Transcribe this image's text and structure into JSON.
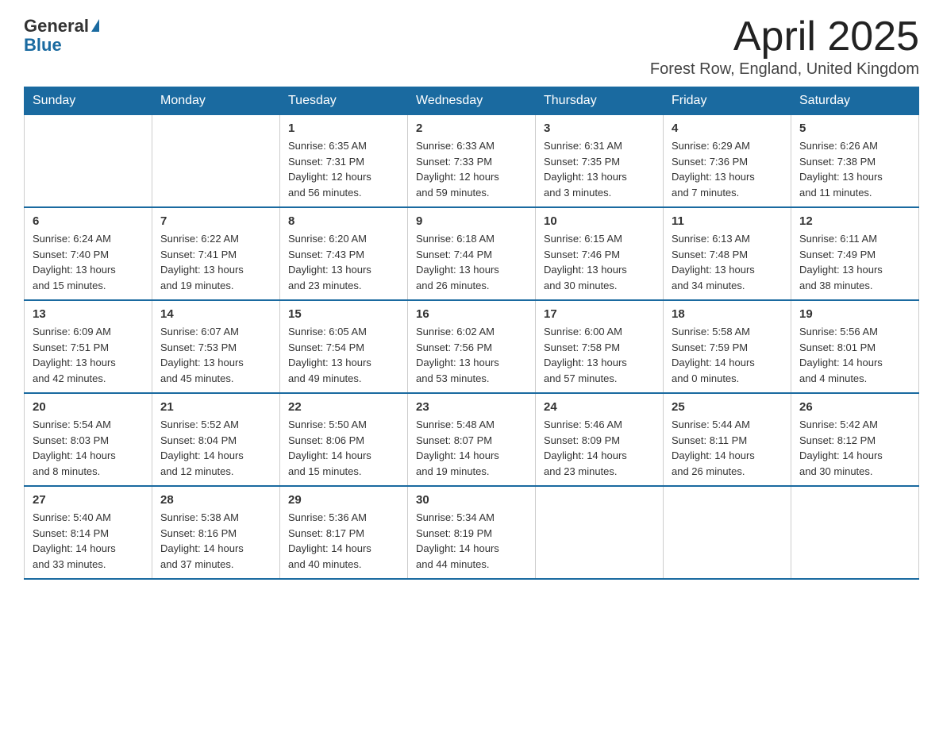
{
  "header": {
    "logo_general": "General",
    "logo_blue": "Blue",
    "month_title": "April 2025",
    "location": "Forest Row, England, United Kingdom"
  },
  "days_of_week": [
    "Sunday",
    "Monday",
    "Tuesday",
    "Wednesday",
    "Thursday",
    "Friday",
    "Saturday"
  ],
  "weeks": [
    [
      {
        "day": "",
        "info": ""
      },
      {
        "day": "",
        "info": ""
      },
      {
        "day": "1",
        "info": "Sunrise: 6:35 AM\nSunset: 7:31 PM\nDaylight: 12 hours\nand 56 minutes."
      },
      {
        "day": "2",
        "info": "Sunrise: 6:33 AM\nSunset: 7:33 PM\nDaylight: 12 hours\nand 59 minutes."
      },
      {
        "day": "3",
        "info": "Sunrise: 6:31 AM\nSunset: 7:35 PM\nDaylight: 13 hours\nand 3 minutes."
      },
      {
        "day": "4",
        "info": "Sunrise: 6:29 AM\nSunset: 7:36 PM\nDaylight: 13 hours\nand 7 minutes."
      },
      {
        "day": "5",
        "info": "Sunrise: 6:26 AM\nSunset: 7:38 PM\nDaylight: 13 hours\nand 11 minutes."
      }
    ],
    [
      {
        "day": "6",
        "info": "Sunrise: 6:24 AM\nSunset: 7:40 PM\nDaylight: 13 hours\nand 15 minutes."
      },
      {
        "day": "7",
        "info": "Sunrise: 6:22 AM\nSunset: 7:41 PM\nDaylight: 13 hours\nand 19 minutes."
      },
      {
        "day": "8",
        "info": "Sunrise: 6:20 AM\nSunset: 7:43 PM\nDaylight: 13 hours\nand 23 minutes."
      },
      {
        "day": "9",
        "info": "Sunrise: 6:18 AM\nSunset: 7:44 PM\nDaylight: 13 hours\nand 26 minutes."
      },
      {
        "day": "10",
        "info": "Sunrise: 6:15 AM\nSunset: 7:46 PM\nDaylight: 13 hours\nand 30 minutes."
      },
      {
        "day": "11",
        "info": "Sunrise: 6:13 AM\nSunset: 7:48 PM\nDaylight: 13 hours\nand 34 minutes."
      },
      {
        "day": "12",
        "info": "Sunrise: 6:11 AM\nSunset: 7:49 PM\nDaylight: 13 hours\nand 38 minutes."
      }
    ],
    [
      {
        "day": "13",
        "info": "Sunrise: 6:09 AM\nSunset: 7:51 PM\nDaylight: 13 hours\nand 42 minutes."
      },
      {
        "day": "14",
        "info": "Sunrise: 6:07 AM\nSunset: 7:53 PM\nDaylight: 13 hours\nand 45 minutes."
      },
      {
        "day": "15",
        "info": "Sunrise: 6:05 AM\nSunset: 7:54 PM\nDaylight: 13 hours\nand 49 minutes."
      },
      {
        "day": "16",
        "info": "Sunrise: 6:02 AM\nSunset: 7:56 PM\nDaylight: 13 hours\nand 53 minutes."
      },
      {
        "day": "17",
        "info": "Sunrise: 6:00 AM\nSunset: 7:58 PM\nDaylight: 13 hours\nand 57 minutes."
      },
      {
        "day": "18",
        "info": "Sunrise: 5:58 AM\nSunset: 7:59 PM\nDaylight: 14 hours\nand 0 minutes."
      },
      {
        "day": "19",
        "info": "Sunrise: 5:56 AM\nSunset: 8:01 PM\nDaylight: 14 hours\nand 4 minutes."
      }
    ],
    [
      {
        "day": "20",
        "info": "Sunrise: 5:54 AM\nSunset: 8:03 PM\nDaylight: 14 hours\nand 8 minutes."
      },
      {
        "day": "21",
        "info": "Sunrise: 5:52 AM\nSunset: 8:04 PM\nDaylight: 14 hours\nand 12 minutes."
      },
      {
        "day": "22",
        "info": "Sunrise: 5:50 AM\nSunset: 8:06 PM\nDaylight: 14 hours\nand 15 minutes."
      },
      {
        "day": "23",
        "info": "Sunrise: 5:48 AM\nSunset: 8:07 PM\nDaylight: 14 hours\nand 19 minutes."
      },
      {
        "day": "24",
        "info": "Sunrise: 5:46 AM\nSunset: 8:09 PM\nDaylight: 14 hours\nand 23 minutes."
      },
      {
        "day": "25",
        "info": "Sunrise: 5:44 AM\nSunset: 8:11 PM\nDaylight: 14 hours\nand 26 minutes."
      },
      {
        "day": "26",
        "info": "Sunrise: 5:42 AM\nSunset: 8:12 PM\nDaylight: 14 hours\nand 30 minutes."
      }
    ],
    [
      {
        "day": "27",
        "info": "Sunrise: 5:40 AM\nSunset: 8:14 PM\nDaylight: 14 hours\nand 33 minutes."
      },
      {
        "day": "28",
        "info": "Sunrise: 5:38 AM\nSunset: 8:16 PM\nDaylight: 14 hours\nand 37 minutes."
      },
      {
        "day": "29",
        "info": "Sunrise: 5:36 AM\nSunset: 8:17 PM\nDaylight: 14 hours\nand 40 minutes."
      },
      {
        "day": "30",
        "info": "Sunrise: 5:34 AM\nSunset: 8:19 PM\nDaylight: 14 hours\nand 44 minutes."
      },
      {
        "day": "",
        "info": ""
      },
      {
        "day": "",
        "info": ""
      },
      {
        "day": "",
        "info": ""
      }
    ]
  ]
}
